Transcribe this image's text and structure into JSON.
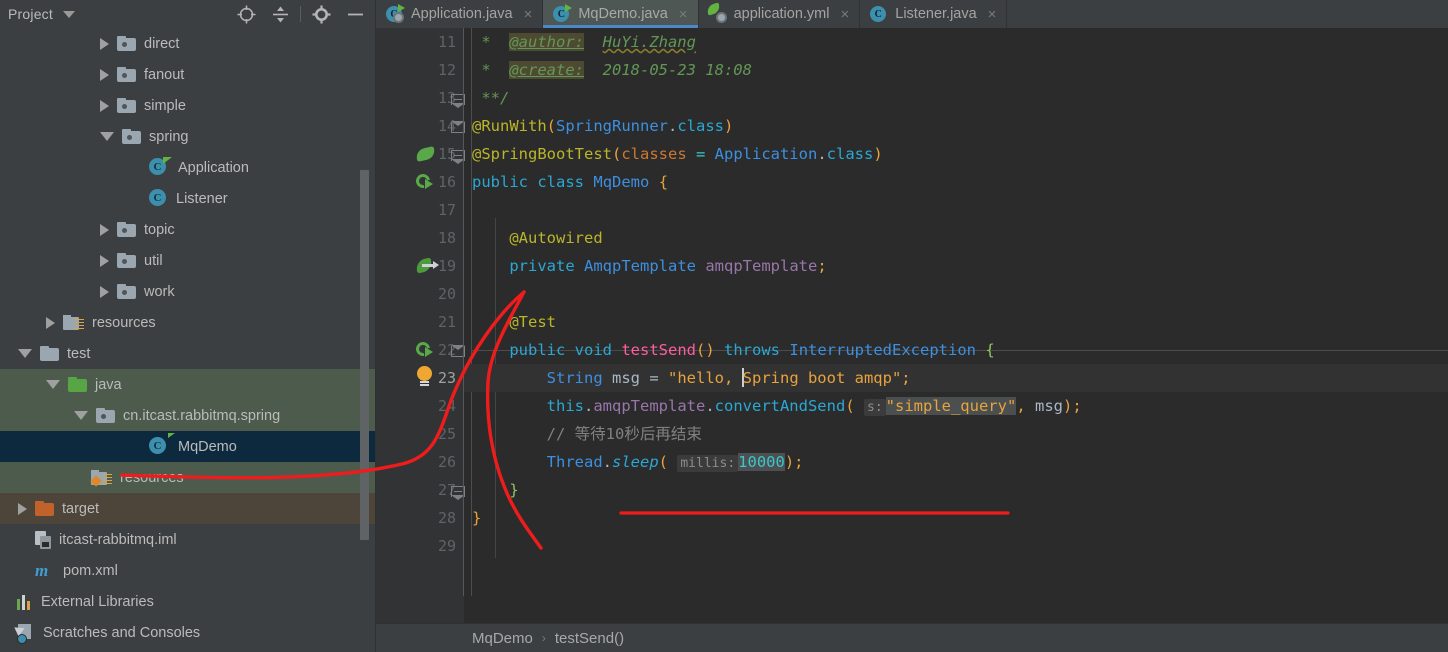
{
  "sidebar": {
    "title": "Project",
    "tools": [
      {
        "name": "locate-icon",
        "glyph": "target"
      },
      {
        "name": "collapse-all-icon",
        "glyph": "collapse"
      },
      {
        "name": "settings-gear-icon",
        "glyph": "gear"
      },
      {
        "name": "hide-icon",
        "glyph": "minus"
      }
    ],
    "items": [
      {
        "label": "direct",
        "icon": "folder",
        "indent": 100,
        "arrow": "right",
        "state": "none"
      },
      {
        "label": "fanout",
        "icon": "folder",
        "indent": 100,
        "arrow": "right",
        "state": "none"
      },
      {
        "label": "simple",
        "icon": "folder",
        "indent": 100,
        "arrow": "right",
        "state": "none"
      },
      {
        "label": "spring",
        "icon": "folder",
        "indent": 100,
        "arrow": "down",
        "state": "none"
      },
      {
        "label": "Application",
        "icon": "spring-class",
        "indent": 132,
        "arrow": "none",
        "state": "none"
      },
      {
        "label": "Listener",
        "icon": "class",
        "indent": 132,
        "arrow": "none",
        "state": "none"
      },
      {
        "label": "topic",
        "icon": "folder",
        "indent": 100,
        "arrow": "right",
        "state": "none"
      },
      {
        "label": "util",
        "icon": "folder",
        "indent": 100,
        "arrow": "right",
        "state": "none"
      },
      {
        "label": "work",
        "icon": "folder",
        "indent": 100,
        "arrow": "right",
        "state": "none"
      },
      {
        "label": "resources",
        "icon": "resources",
        "indent": 46,
        "arrow": "right",
        "state": "none"
      },
      {
        "label": "test",
        "icon": "folder-plain",
        "indent": 18,
        "arrow": "down",
        "state": "none"
      },
      {
        "label": "java",
        "icon": "folder-green",
        "indent": 46,
        "arrow": "down",
        "state": "green"
      },
      {
        "label": "cn.itcast.rabbitmq.spring",
        "icon": "folder",
        "indent": 74,
        "arrow": "down",
        "state": "green"
      },
      {
        "label": "MqDemo",
        "icon": "test-class",
        "indent": 132,
        "arrow": "none",
        "state": "blue"
      },
      {
        "label": "resources",
        "icon": "resources-test",
        "indent": 74,
        "arrow": "none",
        "state": "green"
      },
      {
        "label": "target",
        "icon": "folder-orange",
        "indent": 18,
        "arrow": "right",
        "state": "brown"
      },
      {
        "label": "itcast-rabbitmq.iml",
        "icon": "iml",
        "indent": 18,
        "arrow": "none",
        "state": "none"
      },
      {
        "label": "pom.xml",
        "icon": "maven",
        "indent": 18,
        "arrow": "none",
        "state": "none"
      },
      {
        "label": "External Libraries",
        "icon": "libraries",
        "indent": 0,
        "arrow": "none",
        "state": "none"
      },
      {
        "label": "Scratches and Consoles",
        "icon": "scratches",
        "indent": 0,
        "arrow": "none",
        "state": "none"
      }
    ]
  },
  "editor": {
    "tabs": [
      {
        "label": "Application.java",
        "icon": "spring-class-icon",
        "active": false,
        "close": "×"
      },
      {
        "label": "MqDemo.java",
        "icon": "test-class-icon",
        "active": true,
        "close": "×"
      },
      {
        "label": "application.yml",
        "icon": "spring-yaml-icon",
        "active": false,
        "close": "×"
      },
      {
        "label": "Listener.java",
        "icon": "class-icon",
        "active": false,
        "close": "×"
      }
    ],
    "line_numbers": [
      "11",
      "12",
      "13",
      "14",
      "15",
      "16",
      "17",
      "18",
      "19",
      "20",
      "21",
      "22",
      "23",
      "24",
      "25",
      "26",
      "27",
      "28",
      "29"
    ],
    "current_line": "23",
    "code_lines": [
      " *  @author:  HuYi.Zhang",
      " *  @create:  2018-05-23 18:08",
      " **/",
      "@RunWith(SpringRunner.class)",
      "@SpringBootTest(classes = Application.class)",
      "public class MqDemo {",
      "",
      "    @Autowired",
      "    private AmqpTemplate amqpTemplate;",
      "",
      "    @Test",
      "    public void testSend() throws InterruptedException {",
      "        String msg = \"hello, Spring boot amqp\";",
      "        this.amqpTemplate.convertAndSend( s: \"simple_query\", msg);",
      "        // 等待10秒后再结束",
      "        Thread.sleep( millis: 10000);",
      "    }",
      "}",
      ""
    ],
    "tokens": {
      "author_tag": "@author:",
      "author_value": "HuYi.Zhang",
      "create_tag": "@create:",
      "create_value": "2018-05-23 18:08",
      "doc_end": "**/",
      "anno_runwith": "@RunWith",
      "type_springrunner": "SpringRunner",
      "kw_class": "class",
      "anno_springboottest": "@SpringBootTest",
      "param_classes": "classes",
      "type_application": "Application",
      "kw_public": "public",
      "kw_classkw": "class",
      "type_mqdemo": "MqDemo",
      "anno_autowired": "@Autowired",
      "kw_private": "private",
      "type_amqptemplate": "AmqpTemplate",
      "field_amqptemplate": "amqpTemplate",
      "anno_test": "@Test",
      "kw_void": "void",
      "method_testsend": "testSend",
      "kw_throws": "throws",
      "type_interrupted": "InterruptedException",
      "type_string": "String",
      "var_msg": "msg",
      "str_hello": "\"hello, Spring boot amqp\"",
      "kw_this": "this",
      "method_convertandsend": "convertAndSend",
      "hint_s": "s:",
      "str_simplequery": "\"simple_query\"",
      "comment_cn": "// 等待10秒后再结束",
      "type_thread": "Thread",
      "method_sleep": "sleep",
      "hint_millis": "millis:",
      "num_10000": "10000"
    },
    "breadcrumb": {
      "items": [
        "MqDemo",
        "testSend()"
      ],
      "separator": "›"
    }
  },
  "annotations": {
    "color": "#ee1c1c",
    "shapes": [
      {
        "name": "pointer-curve-to-resources",
        "kind": "path"
      },
      {
        "name": "pointer-curve-down",
        "kind": "path"
      },
      {
        "name": "underline-stroke",
        "kind": "line"
      }
    ]
  },
  "colors": {
    "editor_bg": "#2b2b2b",
    "panel_bg": "#3c3f41",
    "gutter_bg": "#313335",
    "selection_blue": "#0d293e",
    "selection_green": "#4c5b4c",
    "selection_brown": "#4d453a",
    "active_tab": "#4e5754",
    "tab_underline": "#4a88c7",
    "annotation_red": "#ee1c1c",
    "text": "#a9b7c6",
    "keyword": "#cc7832",
    "string": "#e8a33d",
    "number": "#38c8c8",
    "comment": "#808080",
    "javadoc": "#629755",
    "annotation_token": "#bbb529",
    "type": "#3d8fe0",
    "method": "#ff5d9e",
    "field": "#9876aa"
  }
}
